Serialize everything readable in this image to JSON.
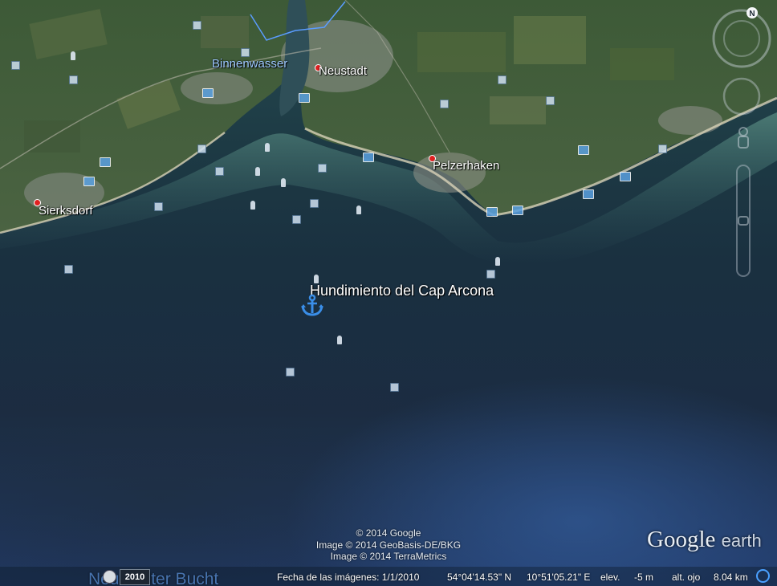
{
  "places": {
    "binnenwasser": "Binnenwasser",
    "neustadt": "Neustadt",
    "pelzerhaken": "Pelzerhaken",
    "sierksdorf": "Sierksdorf",
    "bay": "Neustädter Bucht"
  },
  "marker": {
    "title": "Hundimiento del Cap Arcona",
    "icon": "anchor-icon"
  },
  "credits": {
    "line1": "© 2014 Google",
    "line2": "Image © 2014 GeoBasis-DE/BKG",
    "line3": "Image © 2014 TerraMetrics"
  },
  "logo": {
    "google": "Google",
    "earth": "earth"
  },
  "status": {
    "year": "2010",
    "imagery_date": "Fecha de las imágenes: 1/1/2010",
    "latitude": "54°04'14.53\" N",
    "longitude": "10°51'05.21\" E",
    "elev_label": "elev.",
    "elev_value": "-5 m",
    "eye_label": "alt. ojo",
    "eye_value": "8.04 km"
  },
  "nav": {
    "north_label": "N"
  },
  "colors": {
    "water_label": "#9ec9ff",
    "marker_icon": "#3a8ee8",
    "place_dot": "#e02020"
  }
}
